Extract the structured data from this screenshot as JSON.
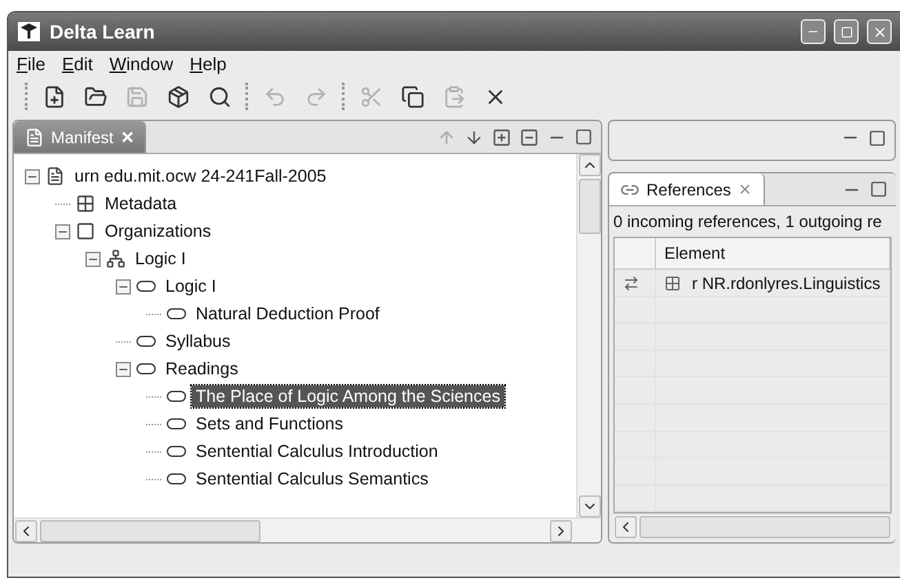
{
  "window": {
    "title": "Delta Learn"
  },
  "menu": [
    {
      "label": "File"
    },
    {
      "label": "Edit"
    },
    {
      "label": "Window"
    },
    {
      "label": "Help"
    }
  ],
  "toolbar": [
    {
      "kind": "new",
      "disabled": false
    },
    {
      "kind": "open",
      "disabled": false
    },
    {
      "kind": "save",
      "disabled": true
    },
    {
      "kind": "import",
      "disabled": false
    },
    {
      "kind": "search",
      "disabled": false
    },
    {
      "kind": "separator"
    },
    {
      "kind": "undo",
      "disabled": true
    },
    {
      "kind": "redo",
      "disabled": true
    },
    {
      "kind": "separator"
    },
    {
      "kind": "cut",
      "disabled": true
    },
    {
      "kind": "copy",
      "disabled": false
    },
    {
      "kind": "paste",
      "disabled": true
    },
    {
      "kind": "delete",
      "disabled": false
    }
  ],
  "manifest": {
    "tab": {
      "label": "Manifest",
      "close": "✕"
    },
    "tree": [
      {
        "label": "urn edu.mit.ocw 24-241Fall-2005",
        "kind": "file",
        "expanded": true,
        "selected": false,
        "children": [
          {
            "label": "Metadata",
            "kind": "metadata",
            "selected": false
          },
          {
            "label": "Organizations",
            "kind": "organizations",
            "expanded": true,
            "selected": false,
            "children": [
              {
                "label": "Logic I",
                "kind": "organization",
                "expanded": true,
                "selected": false,
                "children": [
                  {
                    "label": "Logic I",
                    "kind": "item",
                    "expanded": true,
                    "selected": false,
                    "children": [
                      {
                        "label": "Natural Deduction Proof",
                        "kind": "item",
                        "selected": false
                      }
                    ]
                  },
                  {
                    "label": "Syllabus",
                    "kind": "item",
                    "selected": false
                  },
                  {
                    "label": "Readings",
                    "kind": "item",
                    "expanded": true,
                    "selected": false,
                    "children": [
                      {
                        "label": "The Place of Logic Among the Sciences",
                        "kind": "item",
                        "selected": true
                      },
                      {
                        "label": "Sets and Functions",
                        "kind": "item",
                        "selected": false
                      },
                      {
                        "label": "Sentential Calculus Introduction",
                        "kind": "item",
                        "selected": false
                      },
                      {
                        "label": "Sentential Calculus Semantics",
                        "kind": "item",
                        "selected": false
                      }
                    ]
                  }
                ]
              }
            ]
          }
        ]
      }
    ]
  },
  "references": {
    "tab": {
      "label": "References"
    },
    "summary": "0 incoming references, 1 outgoing re",
    "columns": [
      "Element"
    ],
    "rows": [
      {
        "element": "r NR.rdonlyres.Linguistics"
      }
    ]
  }
}
